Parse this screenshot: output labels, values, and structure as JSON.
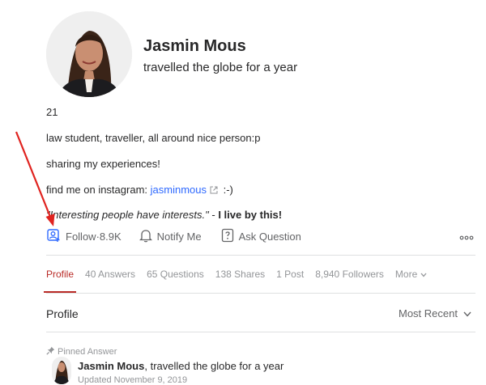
{
  "profile": {
    "name": "Jasmin Mous",
    "tagline": "travelled the globe for a year",
    "bio_lines": [
      "21",
      "law student, traveller, all around nice person:p",
      "sharing my experiences!"
    ],
    "instagram_prefix": "find me on instagram: ",
    "instagram_handle": "jasminmous",
    "instagram_suffix": " :-)",
    "quote_italic": "\"Interesting people have interests.\"",
    "quote_sep": " - ",
    "quote_bold": "I live by this!"
  },
  "actions": {
    "follow": "Follow",
    "follow_sep": " · ",
    "follow_count": "8.9K",
    "notify": "Notify Me",
    "ask": "Ask Question",
    "more": "•••"
  },
  "tabs": [
    "Profile",
    "40 Answers",
    "65 Questions",
    "138 Shares",
    "1 Post",
    "8,940 Followers",
    "More"
  ],
  "section": {
    "title": "Profile",
    "sort": "Most Recent"
  },
  "pinned": {
    "label": "Pinned Answer",
    "author": "Jasmin Mous",
    "credential": ", travelled the globe for a year",
    "date": "Updated November 9, 2019"
  },
  "colors": {
    "accent": "#b92b27",
    "link": "#2e69ff",
    "annotation_arrow": "#e0231f"
  }
}
